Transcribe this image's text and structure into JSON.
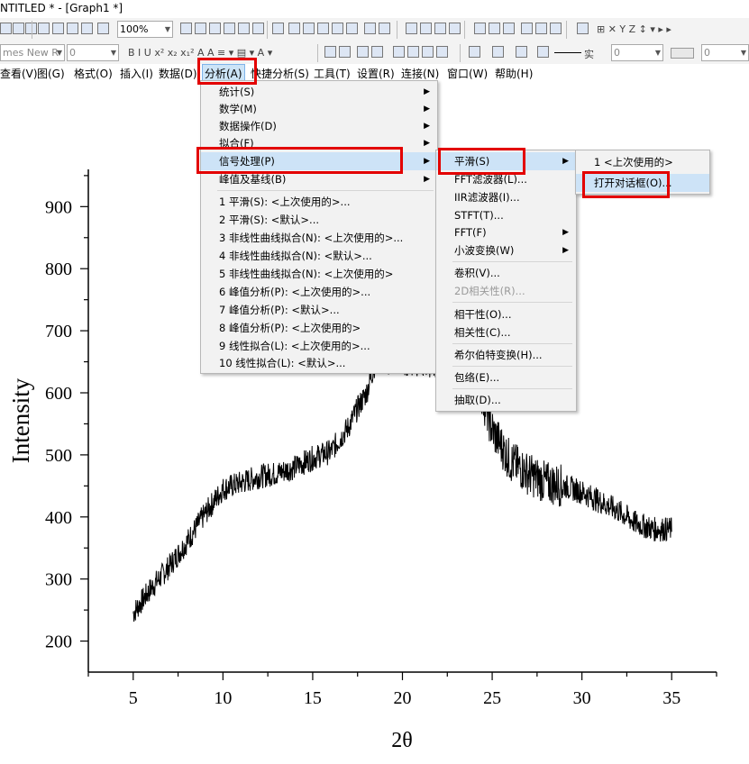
{
  "window": {
    "title": "NTITLED * - [Graph1 *]"
  },
  "toolbar": {
    "zoom": "100%",
    "font": "mes New R",
    "font_size": "0",
    "line_style": "实",
    "line_width": "0",
    "extra_value": "0",
    "format_marks": "B I U x² x₂ x₁² A A ≡ ▾ ▤ ▾ A ▾",
    "right_icons": "⊞ ✕ Y Z ↕ ▾ ▸ ▸"
  },
  "menubar": [
    "查看(V)",
    "图(G)",
    "格式(O)",
    "插入(I)",
    "数据(D)",
    "分析(A)",
    "快捷分析(S)",
    "工具(T)",
    "设置(R)",
    "连接(N)",
    "窗口(W)",
    "帮助(H)"
  ],
  "analysis_menu": {
    "items": [
      "统计(S)",
      "数学(M)",
      "数据操作(D)",
      "拟合(F)",
      "信号处理(P)",
      "峰值及基线(B)",
      "1 平滑(S): <上次使用的>...",
      "2 平滑(S): <默认>...",
      "3 非线性曲线拟合(N): <上次使用的>...",
      "4 非线性曲线拟合(N): <默认>...",
      "5 非线性曲线拟合(N): <上次使用的>",
      "6 峰值分析(P): <上次使用的>...",
      "7 峰值分析(P): <默认>...",
      "8 峰值分析(P): <上次使用的>",
      "9 线性拟合(L): <上次使用的>...",
      "10 线性拟合(L): <默认>..."
    ]
  },
  "signal_menu": {
    "items": [
      "平滑(S)",
      "FFT滤波器(L)...",
      "IIR滤波器(I)...",
      "STFT(T)...",
      "FFT(F)",
      "小波变换(W)",
      "卷积(V)...",
      "2D相关性(R)...",
      "相干性(O)...",
      "相关性(C)...",
      "希尔伯特变换(H)...",
      "包络(E)...",
      "抽取(D)..."
    ]
  },
  "smooth_menu": {
    "items": [
      "1 <上次使用的>",
      "打开对话框(O)..."
    ]
  },
  "chart_data": {
    "type": "line",
    "xlabel": "2θ",
    "ylabel": "Intensity",
    "xlim": [
      2.5,
      37.5
    ],
    "ylim": [
      150,
      960
    ],
    "xticks": [
      5,
      10,
      15,
      20,
      25,
      30,
      35
    ],
    "yticks": [
      200,
      300,
      400,
      500,
      600,
      700,
      800,
      900
    ],
    "series": [
      {
        "color": "#000000",
        "x": [
          5,
          6,
          7,
          8,
          9,
          10,
          11,
          12,
          13,
          14,
          15,
          16,
          17,
          17.5,
          18,
          18.5,
          24,
          25,
          26,
          27,
          28,
          29,
          30,
          31,
          32,
          33,
          34,
          35
        ],
        "y": [
          245,
          285,
          320,
          360,
          405,
          445,
          455,
          465,
          470,
          480,
          495,
          505,
          545,
          575,
          600,
          650,
          640,
          540,
          490,
          470,
          455,
          450,
          440,
          425,
          410,
          390,
          380,
          380
        ]
      }
    ]
  }
}
